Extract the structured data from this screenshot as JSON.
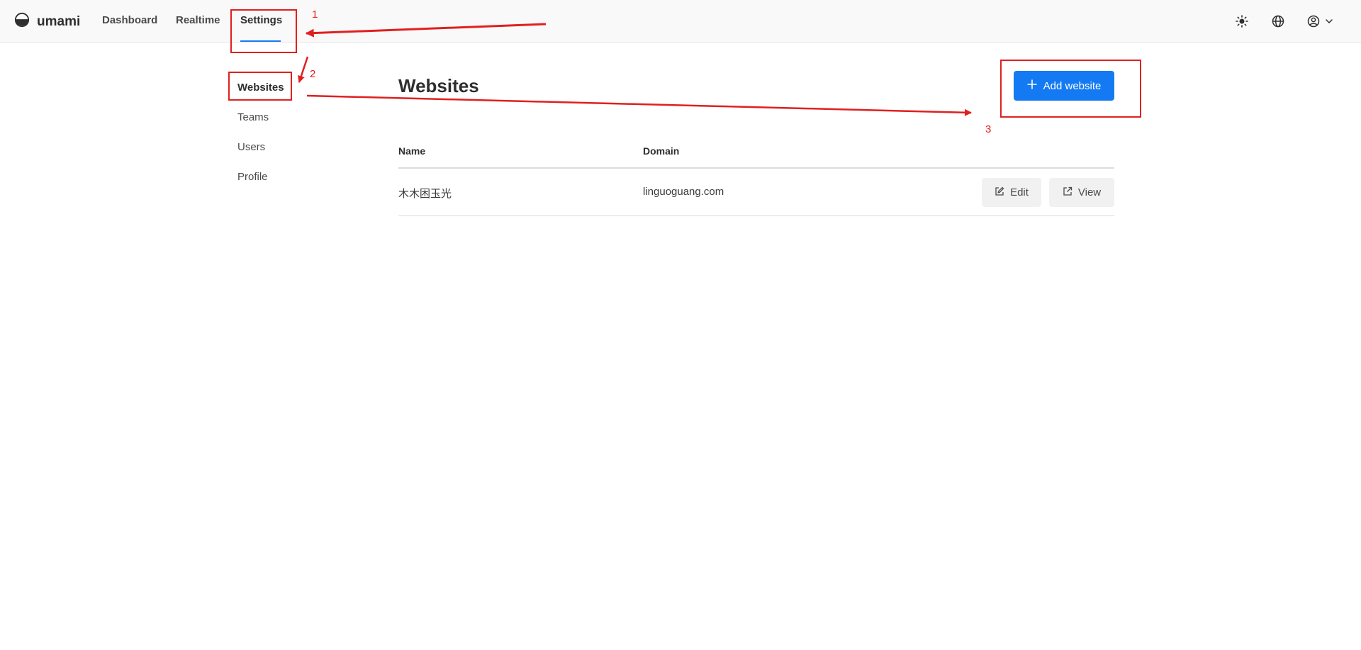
{
  "app": {
    "name": "umami"
  },
  "nav": {
    "items": [
      {
        "label": "Dashboard"
      },
      {
        "label": "Realtime"
      },
      {
        "label": "Settings"
      }
    ]
  },
  "sidebar": {
    "items": [
      {
        "label": "Websites"
      },
      {
        "label": "Teams"
      },
      {
        "label": "Users"
      },
      {
        "label": "Profile"
      }
    ]
  },
  "main": {
    "title": "Websites",
    "add_button": "Add website",
    "table": {
      "columns": [
        "Name",
        "Domain"
      ],
      "rows": [
        {
          "name": "木木困玉光",
          "domain": "linguoguang.com",
          "edit": "Edit",
          "view": "View"
        }
      ]
    }
  },
  "icons": [
    "logo-icon",
    "sun-icon",
    "globe-icon",
    "user-icon",
    "chevron-down-icon",
    "plus-icon",
    "edit-icon",
    "external-link-icon"
  ],
  "annotations": {
    "labels": [
      "1",
      "2",
      "3"
    ],
    "color": "#e0201e"
  },
  "colors": {
    "accent": "#147af3"
  }
}
